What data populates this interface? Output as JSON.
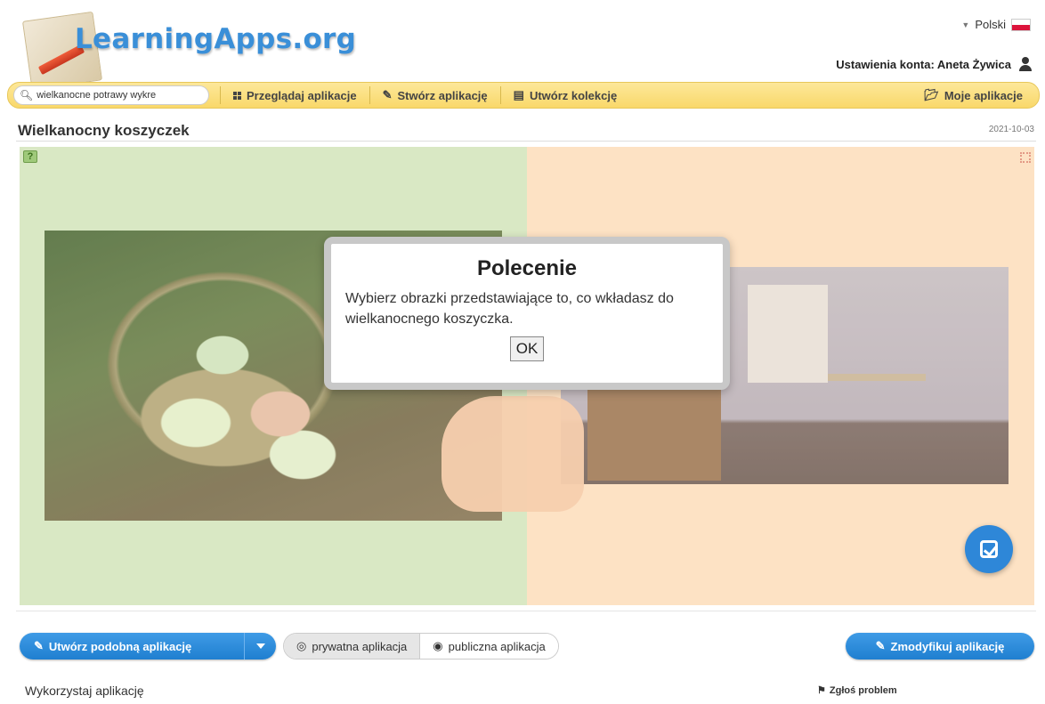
{
  "header": {
    "logo_text": "LearningApps.org",
    "language": "Polski",
    "account": "Ustawienia konta: Aneta Żywica"
  },
  "nav": {
    "search_value": "wielkanocne potrawy wykre",
    "browse": "Przeglądaj aplikacje",
    "create": "Stwórz aplikację",
    "collection": "Utwórz kolekcję",
    "my_apps": "Moje aplikacje"
  },
  "app": {
    "title": "Wielkanocny koszyczek",
    "date": "2021-10-03"
  },
  "modal": {
    "heading": "Polecenie",
    "text": "Wybierz obrazki przedstawiające to, co wkładasz do wielkanocnego koszyczka.",
    "ok": "OK"
  },
  "actions": {
    "create_similar": "Utwórz podobną aplikację",
    "private": "prywatna aplikacja",
    "public": "publiczna aplikacja",
    "modify": "Zmodyfikuj aplikację"
  },
  "footer": {
    "use_app": "Wykorzystaj aplikację",
    "report": "Zgłoś problem"
  },
  "icons": {
    "search": "search-icon",
    "grid": "grid-icon",
    "pencil": "pencil-icon",
    "collection": "collection-icon",
    "folder": "folder-icon",
    "user": "user-icon",
    "help": "help-icon",
    "fullscreen": "fullscreen-icon",
    "check": "check-icon",
    "eye": "eye-icon",
    "eye_slash": "eye-slash-icon",
    "flag": "flag-icon"
  },
  "colors": {
    "nav_bar": "#f9d86a",
    "accent_blue": "#2e87d8",
    "left_panel": "#d9e8c4",
    "right_panel": "#fde2c4"
  }
}
